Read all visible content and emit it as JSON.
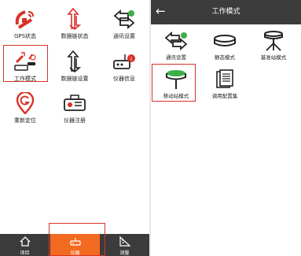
{
  "left": {
    "items": [
      {
        "label": "GPS状态",
        "icon": "satellite-dish-icon"
      },
      {
        "label": "数据链状态",
        "icon": "link-arrows-icon"
      },
      {
        "label": "通讯设置",
        "icon": "communication-arrows-icon"
      },
      {
        "label": "工作模式",
        "icon": "work-mode-icon"
      },
      {
        "label": "数据链设置",
        "icon": "link-settings-icon"
      },
      {
        "label": "仪器信息",
        "icon": "device-info-icon"
      },
      {
        "label": "重新定位",
        "icon": "relocate-icon"
      },
      {
        "label": "仪器注册",
        "icon": "device-register-icon"
      }
    ],
    "tabs": [
      {
        "label": "项目",
        "icon": "home-icon"
      },
      {
        "label": "仪器",
        "icon": "device-icon",
        "active": true
      },
      {
        "label": "测量",
        "icon": "ruler-icon"
      }
    ]
  },
  "right": {
    "title": "工作模式",
    "items": [
      {
        "label": "通讯设置",
        "icon": "communication-arrows-icon"
      },
      {
        "label": "静态模式",
        "icon": "static-receiver-icon"
      },
      {
        "label": "基准站模式",
        "icon": "base-station-icon"
      },
      {
        "label": "移动站模式",
        "icon": "rover-icon"
      },
      {
        "label": "调用配置集",
        "icon": "config-set-icon"
      }
    ]
  },
  "colors": {
    "accent_red": "#d8322a",
    "tab_active": "#f36b21",
    "bar_dark": "#3b3b3b",
    "icon_green": "#3cb04a"
  }
}
